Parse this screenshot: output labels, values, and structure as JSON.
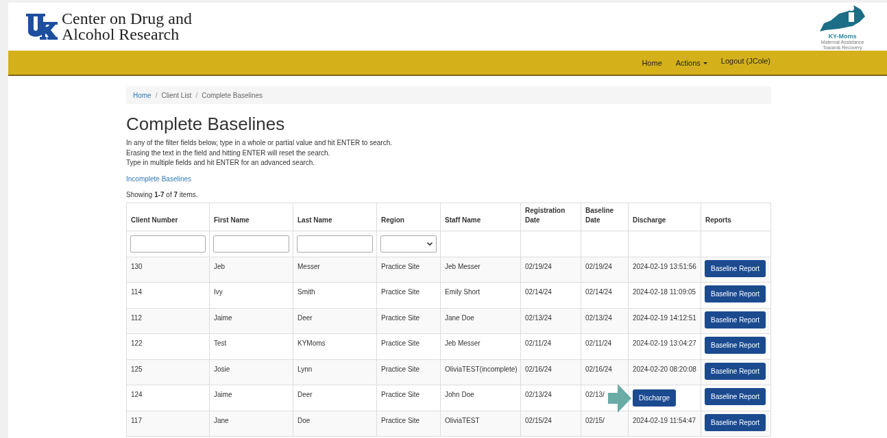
{
  "header": {
    "logo_text": [
      "Center on Drug and",
      "Alcohol Research"
    ],
    "partner_logo": {
      "title": "KY-Moms",
      "subtitle": [
        "Maternal Assistance",
        "Towards Recovery"
      ]
    }
  },
  "nav": {
    "items": [
      {
        "label": "Home",
        "kind": "link"
      },
      {
        "label": "Actions",
        "kind": "dropdown"
      },
      {
        "label": "Logout (JCole)",
        "kind": "link"
      }
    ]
  },
  "breadcrumb_separator": "/",
  "breadcrumb": [
    {
      "label": "Home",
      "kind": "link"
    },
    {
      "label": "Client List",
      "kind": "text"
    },
    {
      "label": "Complete Baselines",
      "kind": "text"
    }
  ],
  "page": {
    "title": "Complete Baselines",
    "instructions": [
      "In any of the filter fields below, type in a whole or partial value and hit ENTER to search.",
      "Erasing the text in the field and hitting ENTER will reset the search.",
      "Type in multiple fields and hit ENTER for an advanced search."
    ],
    "link": "Incomplete Baselines",
    "summary": "Showing **1-7** of **7** items."
  },
  "table": {
    "columns": [
      {
        "label": "Client Number",
        "kind": "text"
      },
      {
        "label": "First Name",
        "kind": "text"
      },
      {
        "label": "Last Name",
        "kind": "text"
      },
      {
        "label": "Region",
        "kind": "select"
      },
      {
        "label": "Staff Name",
        "kind": "plain"
      },
      {
        "label": "Registration Date",
        "kind": "plain"
      },
      {
        "label": "Baseline Date",
        "kind": "plain"
      },
      {
        "label": "Discharge",
        "kind": "plain"
      },
      {
        "label": "Reports",
        "kind": "plain"
      }
    ],
    "rows": [
      {
        "cells": [
          "130",
          "Jeb",
          "Messer",
          "Practice Site",
          "Jeb Messer",
          "02/19/24",
          "02/19/24"
        ],
        "discharge": {
          "kind": "text",
          "value": "2024-02-19 13:51:56"
        },
        "report": "Baseline Report"
      },
      {
        "cells": [
          "114",
          "Ivy",
          "Smith",
          "Practice Site",
          "Emily Short",
          "02/14/24",
          "02/14/24"
        ],
        "discharge": {
          "kind": "text",
          "value": "2024-02-18 11:09:05"
        },
        "report": "Baseline Report"
      },
      {
        "cells": [
          "112",
          "Jaime",
          "Deer",
          "Practice Site",
          "Jane Doe",
          "02/13/24",
          "02/13/24"
        ],
        "discharge": {
          "kind": "text",
          "value": "2024-02-19 14:12:51"
        },
        "report": "Baseline Report"
      },
      {
        "cells": [
          "122",
          "Test",
          "KYMoms",
          "Practice Site",
          "Jeb Messer",
          "02/11/24",
          "02/11/24"
        ],
        "discharge": {
          "kind": "text",
          "value": "2024-02-19 13:04:27"
        },
        "report": "Baseline Report"
      },
      {
        "cells": [
          "125",
          "Josie",
          "Lynn",
          "Practice Site",
          "OliviaTEST(incomplete)",
          "02/16/24",
          "02/16/24"
        ],
        "discharge": {
          "kind": "text",
          "value": "2024-02-20 08:20:08"
        },
        "report": "Baseline Report"
      },
      {
        "cells": [
          "124",
          "Jaime",
          "Deer",
          "Practice Site",
          "John Doe",
          "02/13/24",
          "02/13/"
        ],
        "discharge": {
          "kind": "button",
          "value": "Discharge"
        },
        "report": "Baseline Report",
        "arrow": true
      },
      {
        "cells": [
          "117",
          "Jane",
          "Doe",
          "Practice Site",
          "OliviaTEST",
          "02/15/24",
          "02/15/"
        ],
        "discharge": {
          "kind": "text",
          "value": "2024-02-19 11:54:47"
        },
        "report": "Baseline Report"
      }
    ]
  }
}
